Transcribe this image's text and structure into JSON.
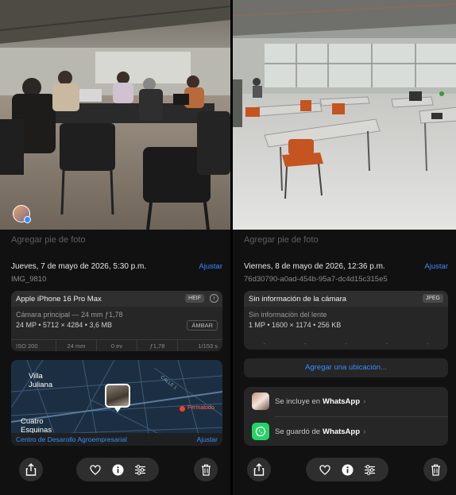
{
  "left": {
    "caption_placeholder": "Agregar pie de foto",
    "date": "Jueves, 7 de mayo de 2026, 5:30 p.m.",
    "adjust_label": "Ajustar",
    "filename": "IMG_9810",
    "camera": {
      "model": "Apple iPhone 16 Pro Max",
      "format_tag": "HEIF",
      "lens": "Cámara principal — 24 mm ƒ1,78",
      "specs": "24 MP • 5712 × 4284 • 3,6 MB",
      "style_tag": "ÁMBAR",
      "metrics": [
        "ISO 200",
        "24 mm",
        "0 ev",
        "ƒ1,78",
        "1/153 s"
      ]
    },
    "map": {
      "labels": [
        "Villa",
        "Juliana",
        "Cuatro",
        "Esquinas"
      ],
      "street_label": "CALLE 1",
      "place_marker": "Fermatodo",
      "location_name": "Centro de Desarollo Agroempresarial",
      "adjust_label": "Ajustar"
    }
  },
  "right": {
    "caption_placeholder": "Agregar pie de foto",
    "date": "Viernes, 8 de mayo de 2026, 12:36 p.m.",
    "adjust_label": "Ajustar",
    "filename": "76d30790-a0ad-454b-95a7-dc4d15c315e5",
    "camera": {
      "title": "Sin información de la cámara",
      "format_tag": "JPEG",
      "lens": "Sin información del lente",
      "specs": "1 MP • 1600 × 1174 • 256 KB",
      "metrics": [
        "-",
        "-",
        "-",
        "-",
        "-"
      ]
    },
    "add_location": "Agregar una ubicación...",
    "whatsapp": {
      "included_prefix": "Se incluye en",
      "saved_prefix": "Se guardó de",
      "app_name": "WhatsApp"
    }
  },
  "icons": [
    "share-icon",
    "heart-icon",
    "info-icon",
    "adjust-sliders-icon",
    "trash-icon",
    "profile-badge-icon"
  ],
  "colors": {
    "accent": "#3a8bff",
    "background": "#111111",
    "card": "#262626",
    "whatsapp": "#25d366"
  }
}
